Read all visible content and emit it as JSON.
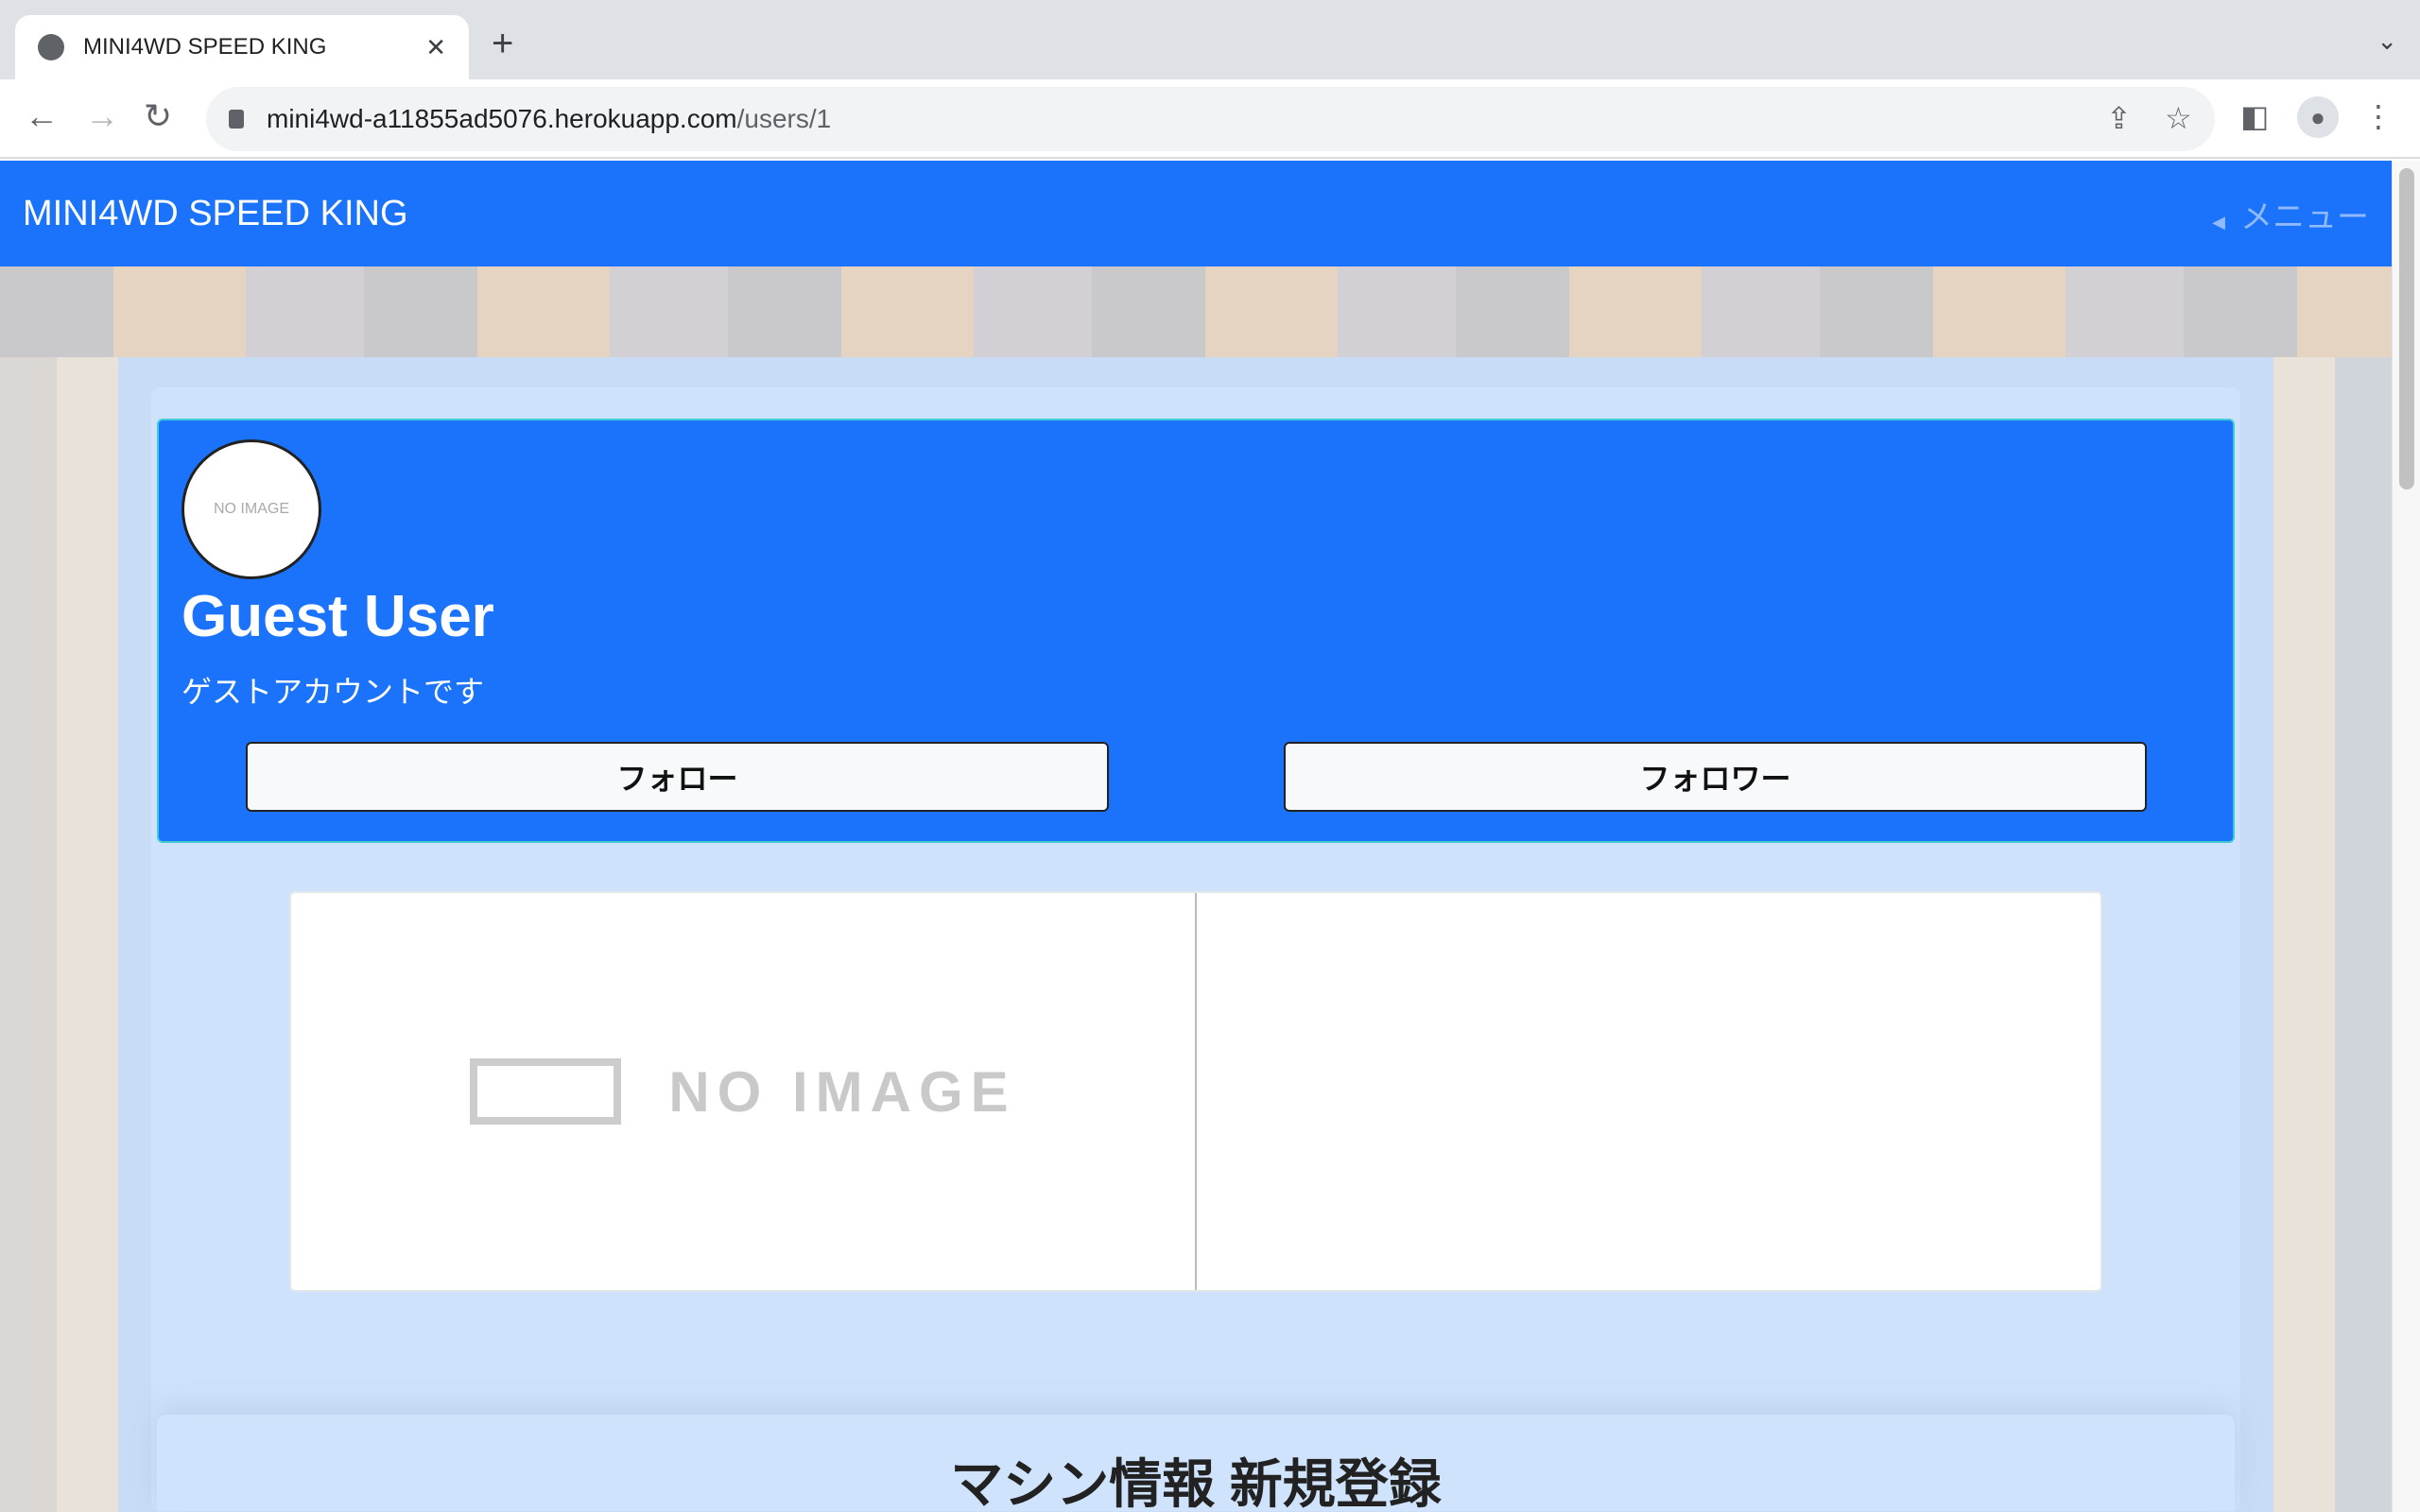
{
  "browser": {
    "tab_title": "MINI4WD SPEED KING",
    "url_host": "mini4wd-a11855ad5076.herokuapp.com",
    "url_path": "/users/1"
  },
  "navbar": {
    "brand": "MINI4WD SPEED KING",
    "menu_label": "メニュー"
  },
  "profile": {
    "avatar_text": "NO IMAGE",
    "name": "Guest User",
    "bio": "ゲストアカウントです",
    "follow_label": "フォロー",
    "follower_label": "フォロワー"
  },
  "machine_card": {
    "image_text": "NO IMAGE"
  },
  "new_machine": {
    "heading": "マシン情報 新規登録"
  }
}
